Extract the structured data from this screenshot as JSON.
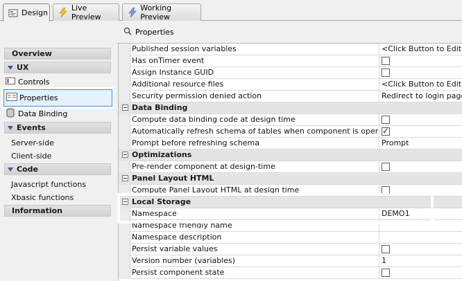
{
  "tabs": [
    {
      "label": "Design",
      "icon": "design-icon"
    },
    {
      "label": "Live Preview",
      "icon": "lightning-icon"
    },
    {
      "label": "Working Preview",
      "icon": "lightning-icon"
    }
  ],
  "panel_title": "Properties",
  "left": {
    "overview": "Overview",
    "ux": "UX",
    "controls": "Controls",
    "properties": "Properties",
    "data_binding": "Data Binding",
    "events": "Events",
    "server_side": "Server-side",
    "client_side": "Client-side",
    "code": "Code",
    "js_functions": "Javascript functions",
    "xbasic_functions": "Xbasic functions",
    "information": "Information"
  },
  "rows": [
    {
      "type": "prop",
      "name": "Published session variables",
      "value": "<Click Button to Edit>"
    },
    {
      "type": "prop",
      "name": "Has onTimer event",
      "check": false
    },
    {
      "type": "prop",
      "name": "Assign Instance GUID",
      "check": false
    },
    {
      "type": "prop",
      "name": "Additional resource files",
      "value": "<Click Button to Edit>"
    },
    {
      "type": "prop",
      "name": "Security permission denied action",
      "value": "Redirect to login page"
    },
    {
      "type": "section",
      "name": "Data Binding"
    },
    {
      "type": "prop",
      "name": "Compute data binding code at design time",
      "check": false
    },
    {
      "type": "prop",
      "name": "Automatically refresh schema of tables when component is opened for editing",
      "check": true
    },
    {
      "type": "prop",
      "name": "Prompt before refreshing schema",
      "value": "Prompt"
    },
    {
      "type": "section",
      "name": "Optimizations"
    },
    {
      "type": "prop",
      "name": "Pre-render component at design-time",
      "check": false
    },
    {
      "type": "section",
      "name": "Panel Layout HTML"
    },
    {
      "type": "prop",
      "name": "Compute Panel Layout HTML at design time",
      "check": false
    },
    {
      "type": "section",
      "name": "Local Storage"
    },
    {
      "type": "prop",
      "name": "Namespace",
      "value": "DEMO1"
    },
    {
      "type": "prop",
      "name": "Namespace friendly name",
      "value": ""
    },
    {
      "type": "prop",
      "name": "Namespace description",
      "value": ""
    },
    {
      "type": "prop",
      "name": "Persist variable values",
      "check": false
    },
    {
      "type": "prop",
      "name": "Version number (variables)",
      "value": "1"
    },
    {
      "type": "prop",
      "name": "Persist component state",
      "check": false
    }
  ]
}
